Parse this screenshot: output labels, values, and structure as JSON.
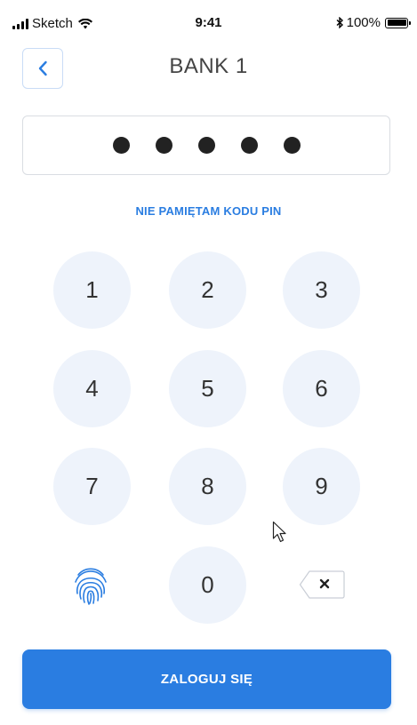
{
  "status_bar": {
    "carrier": "Sketch",
    "time": "9:41",
    "battery": "100%"
  },
  "header": {
    "title": "BANK 1",
    "back_icon": "chevron-left-icon"
  },
  "pin": {
    "entered_digits": 5
  },
  "forgot_pin_label": "NIE PAMIĘTAM KODU PIN",
  "keypad": {
    "keys": [
      "1",
      "2",
      "3",
      "4",
      "5",
      "6",
      "7",
      "8",
      "9",
      "0"
    ],
    "fingerprint_icon": "fingerprint-icon",
    "backspace_icon": "backspace-icon"
  },
  "login_button_label": "ZALOGUJ SIĘ",
  "colors": {
    "accent": "#2a7de1",
    "key_background": "#eef3fb"
  }
}
